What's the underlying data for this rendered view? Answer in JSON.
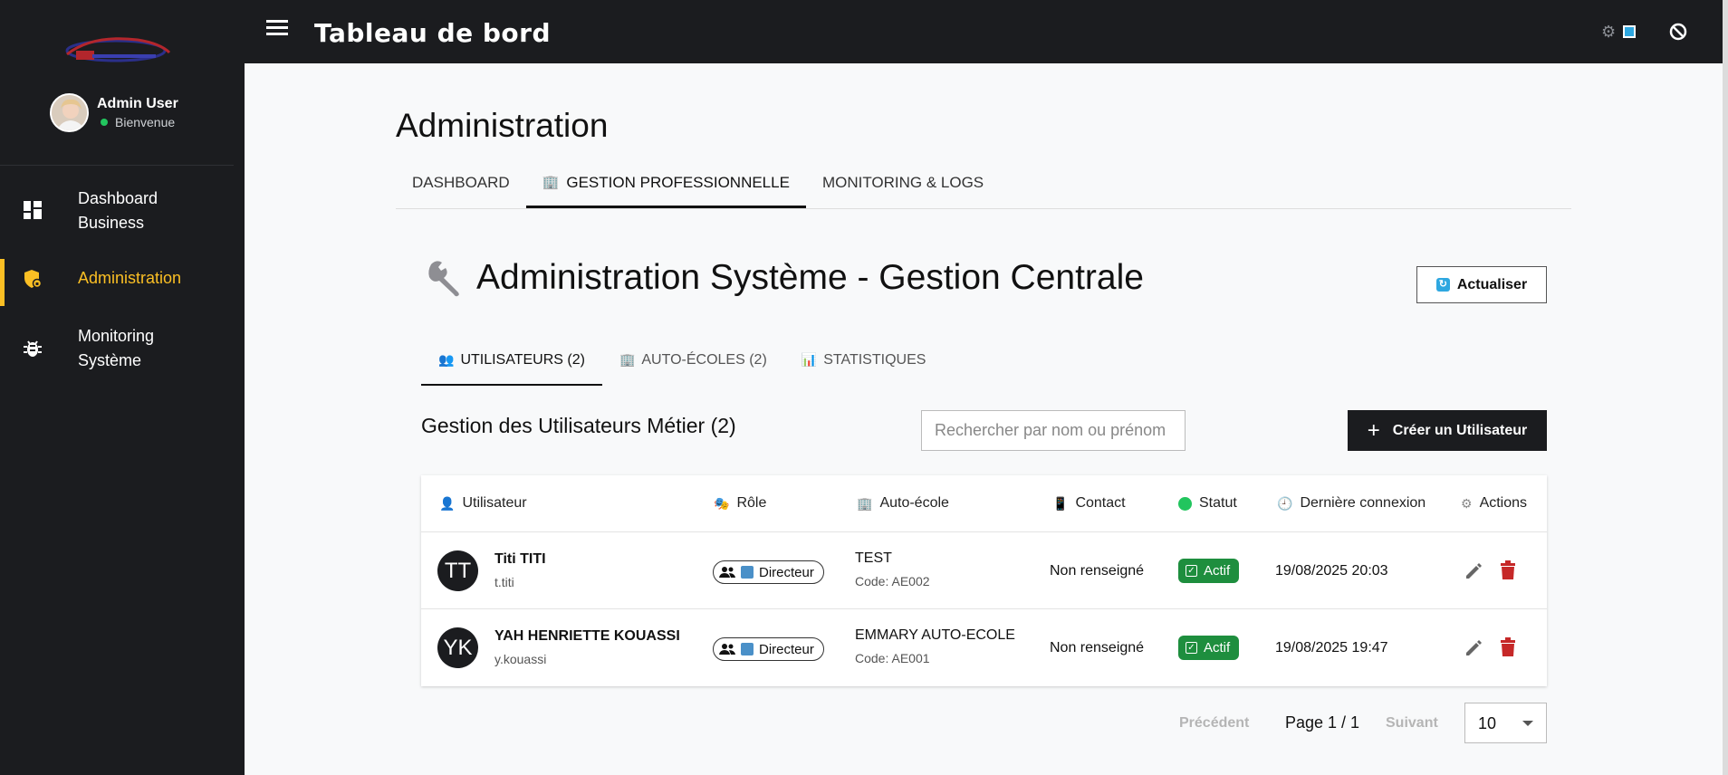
{
  "topbar": {
    "title": "Tableau de bord"
  },
  "profile": {
    "name": "Admin User",
    "status": "Bienvenue"
  },
  "sidebar": {
    "items": [
      {
        "line1": "Dashboard",
        "line2": "Business",
        "icon": "dashboard-icon"
      },
      {
        "line1": "Administration",
        "line2": "",
        "icon": "shield-icon"
      },
      {
        "line1": "Monitoring",
        "line2": "Système",
        "icon": "bug-icon"
      }
    ]
  },
  "page": {
    "title": "Administration"
  },
  "main_tabs": [
    "DASHBOARD",
    "GESTION PROFESSIONNELLE",
    "MONITORING & LOGS"
  ],
  "section": {
    "title": "Administration Système - Gestion Centrale",
    "refresh_label": "Actualiser"
  },
  "sub_tabs": [
    "UTILISATEURS (2)",
    "AUTO-ÉCOLES (2)",
    "STATISTIQUES"
  ],
  "users": {
    "title": "Gestion des Utilisateurs Métier (2)",
    "search_placeholder": "Rechercher par nom ou prénom",
    "create_label": "Créer un Utilisateur"
  },
  "table": {
    "headers": [
      "Utilisateur",
      "Rôle",
      "Auto-école",
      "Contact",
      "Statut",
      "Dernière connexion",
      "Actions"
    ],
    "rows": [
      {
        "initials": "TT",
        "name": "Titi TITI",
        "login": "t.titi",
        "role": "Directeur",
        "autoecole": "TEST",
        "code": "Code: AE002",
        "contact": "Non renseigné",
        "status": "Actif",
        "last_login": "19/08/2025 20:03"
      },
      {
        "initials": "YK",
        "name": "YAH HENRIETTE KOUASSI",
        "login": "y.kouassi",
        "role": "Directeur",
        "autoecole": "EMMARY AUTO-ECOLE",
        "code": "Code: AE001",
        "contact": "Non renseigné",
        "status": "Actif",
        "last_login": "19/08/2025 19:47"
      }
    ]
  },
  "pagination": {
    "prev": "Précédent",
    "info": "Page 1 / 1",
    "next": "Suivant",
    "page_size": "10"
  },
  "colors": {
    "accent": "#fbbf24",
    "dark": "#1b1c1f",
    "status_green": "#1e8e3e",
    "delete_red": "#c62828"
  }
}
